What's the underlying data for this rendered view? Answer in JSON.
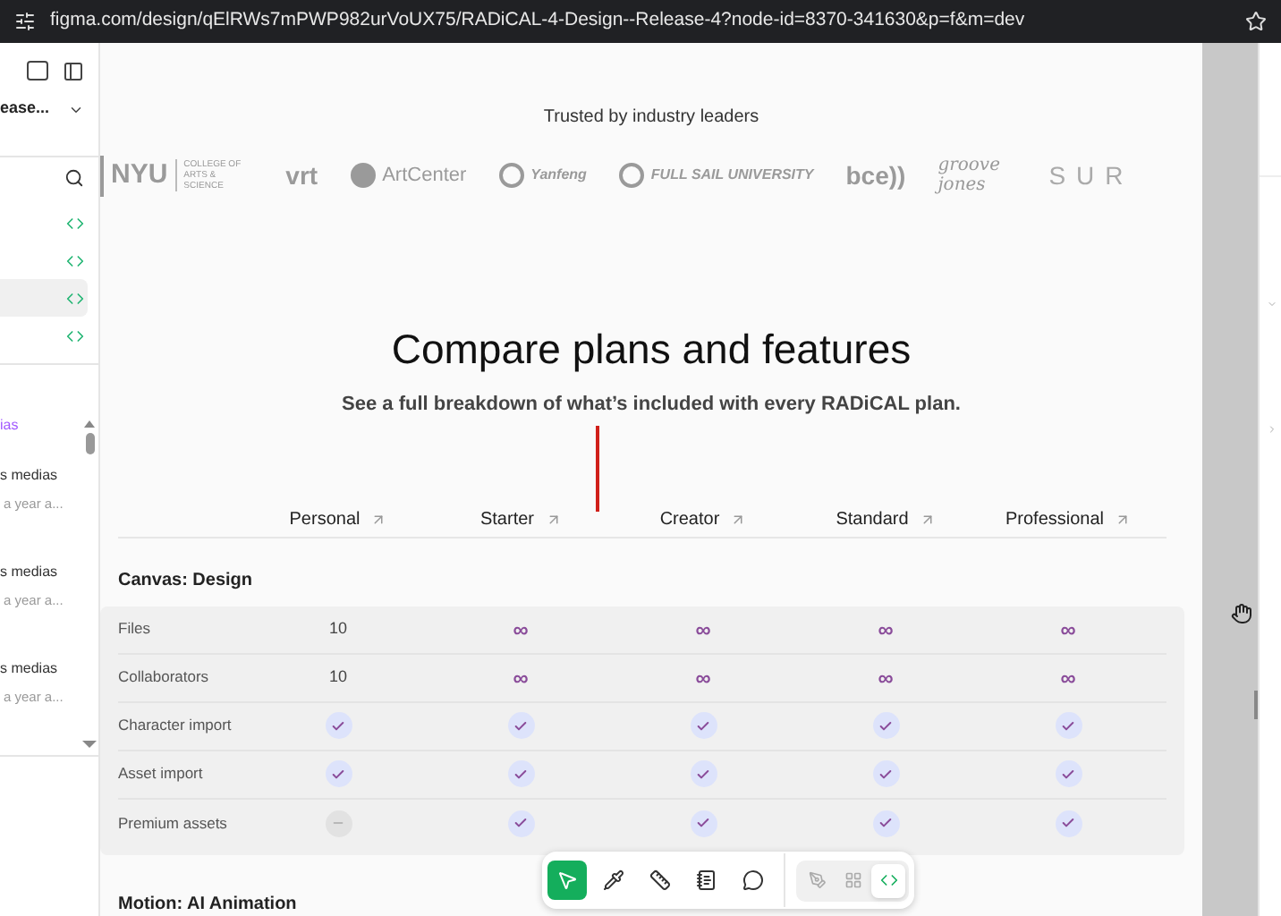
{
  "browser": {
    "url": "figma.com/design/qElRWs7mPWP982urVoUX75/RADiCAL-4-Design--Release-4?node-id=8370-341630&p=f&m=dev",
    "bookmarked": false
  },
  "sidebar": {
    "file_name": "ease...",
    "code_rows": [
      {
        "selected": false
      },
      {
        "selected": false
      },
      {
        "selected": true
      },
      {
        "selected": false
      }
    ],
    "link_text": "ias",
    "items": [
      {
        "title": "s medias",
        "time": "a year a..."
      },
      {
        "title": "s medias",
        "time": "a year a..."
      },
      {
        "title": "s medias",
        "time": "a year a..."
      }
    ]
  },
  "page": {
    "trusted_heading": "Trusted by industry leaders",
    "logos": [
      {
        "kind": "nyu",
        "text": "NYU",
        "subtext": "COLLEGE OF ARTS & SCIENCE"
      },
      {
        "kind": "bold",
        "text": "vrt"
      },
      {
        "kind": "circle",
        "text": "ArtCenter"
      },
      {
        "kind": "badge",
        "text": "Yanfeng"
      },
      {
        "kind": "badge",
        "text": "FULL SAIL UNIVERSITY"
      },
      {
        "kind": "bold",
        "text": "bce))"
      },
      {
        "kind": "script",
        "text": "groove jones"
      },
      {
        "kind": "spaced",
        "text": "SUR"
      }
    ],
    "title": "Compare plans and features",
    "subtitle": "See a full breakdown of what’s included with every RADiCAL plan.",
    "plans": [
      "Personal",
      "Starter",
      "Creator",
      "Standard",
      "Professional"
    ],
    "sections": [
      {
        "title": "Canvas: Design",
        "rows": [
          {
            "label": "Files",
            "cells": [
              {
                "kind": "text",
                "text": "10"
              },
              {
                "kind": "infinity",
                "text": "∞"
              },
              {
                "kind": "infinity",
                "text": "∞"
              },
              {
                "kind": "infinity",
                "text": "∞"
              },
              {
                "kind": "infinity",
                "text": "∞"
              }
            ]
          },
          {
            "label": "Collaborators",
            "cells": [
              {
                "kind": "text",
                "text": "10"
              },
              {
                "kind": "infinity",
                "text": "∞"
              },
              {
                "kind": "infinity",
                "text": "∞"
              },
              {
                "kind": "infinity",
                "text": "∞"
              },
              {
                "kind": "infinity",
                "text": "∞"
              }
            ]
          },
          {
            "label": "Character import",
            "cells": [
              {
                "kind": "check"
              },
              {
                "kind": "check"
              },
              {
                "kind": "check"
              },
              {
                "kind": "check"
              },
              {
                "kind": "check"
              }
            ]
          },
          {
            "label": "Asset import",
            "cells": [
              {
                "kind": "check"
              },
              {
                "kind": "check"
              },
              {
                "kind": "check"
              },
              {
                "kind": "check"
              },
              {
                "kind": "check"
              }
            ]
          },
          {
            "label": "Premium assets",
            "cells": [
              {
                "kind": "none"
              },
              {
                "kind": "check"
              },
              {
                "kind": "check"
              },
              {
                "kind": "check"
              },
              {
                "kind": "check"
              }
            ]
          }
        ]
      },
      {
        "title": "Motion: AI Animation"
      }
    ]
  },
  "toolbar": {
    "tools": [
      {
        "kind": "move",
        "selected": true
      },
      {
        "kind": "dropper",
        "selected": false
      },
      {
        "kind": "ruler",
        "selected": false
      },
      {
        "kind": "notes",
        "selected": false
      },
      {
        "kind": "comment",
        "selected": false
      }
    ],
    "modes": [
      {
        "kind": "draw",
        "selected": false
      },
      {
        "kind": "component",
        "selected": false
      },
      {
        "kind": "code",
        "selected": true
      }
    ]
  }
}
